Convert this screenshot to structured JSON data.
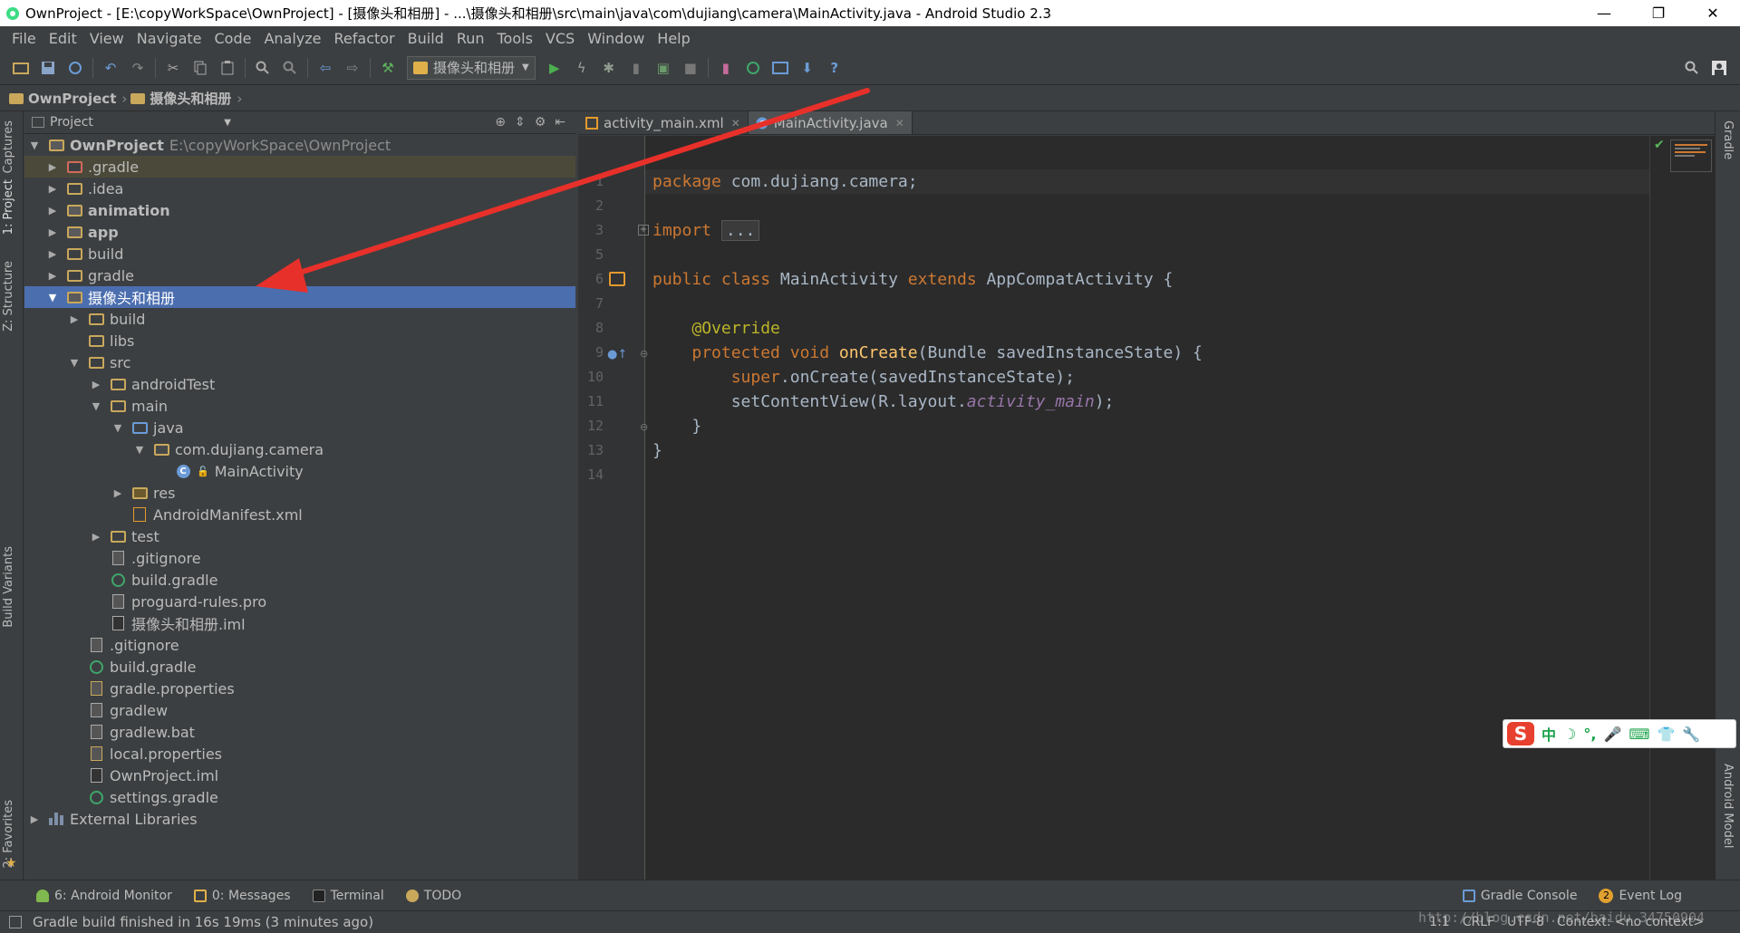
{
  "window": {
    "title": "OwnProject - [E:\\copyWorkSpace\\OwnProject] - [摄像头和相册] - ...\\摄像头和相册\\src\\main\\java\\com\\dujiang\\camera\\MainActivity.java - Android Studio 2.3",
    "minimize": "—",
    "restore": "❐",
    "close": "✕"
  },
  "menu": [
    "File",
    "Edit",
    "View",
    "Navigate",
    "Code",
    "Analyze",
    "Refactor",
    "Build",
    "Run",
    "Tools",
    "VCS",
    "Window",
    "Help"
  ],
  "toolbar": {
    "run_config": "摄像头和相册"
  },
  "navbar": {
    "crumbs": [
      "OwnProject",
      "摄像头和相册"
    ]
  },
  "left_strip": {
    "captures": "Captures",
    "project": "1: Project",
    "structure": "Z: Structure",
    "build_variants": "Build Variants",
    "favorites": "2: Favorites"
  },
  "right_strip": {
    "gradle": "Gradle",
    "android_model": "Android Model"
  },
  "project_panel": {
    "view_selector": "Project",
    "tree": [
      {
        "label": "OwnProject",
        "path": "E:\\copyWorkSpace\\OwnProject"
      },
      {
        "label": ".gradle"
      },
      {
        "label": ".idea"
      },
      {
        "label": "animation"
      },
      {
        "label": "app"
      },
      {
        "label": "build"
      },
      {
        "label": "gradle"
      },
      {
        "label": "摄像头和相册"
      },
      {
        "label": "build"
      },
      {
        "label": "libs"
      },
      {
        "label": "src"
      },
      {
        "label": "androidTest"
      },
      {
        "label": "main"
      },
      {
        "label": "java"
      },
      {
        "label": "com.dujiang.camera"
      },
      {
        "label": "MainActivity"
      },
      {
        "label": "res"
      },
      {
        "label": "AndroidManifest.xml"
      },
      {
        "label": "test"
      },
      {
        "label": ".gitignore"
      },
      {
        "label": "build.gradle"
      },
      {
        "label": "proguard-rules.pro"
      },
      {
        "label": "摄像头和相册.iml"
      },
      {
        "label": ".gitignore"
      },
      {
        "label": "build.gradle"
      },
      {
        "label": "gradle.properties"
      },
      {
        "label": "gradlew"
      },
      {
        "label": "gradlew.bat"
      },
      {
        "label": "local.properties"
      },
      {
        "label": "OwnProject.iml"
      },
      {
        "label": "settings.gradle"
      },
      {
        "label": "External Libraries"
      }
    ]
  },
  "editor": {
    "tabs": [
      "activity_main.xml",
      "MainActivity.java"
    ],
    "line_numbers": [
      "1",
      "2",
      "3",
      "5",
      "6",
      "7",
      "8",
      "9",
      "10",
      "11",
      "12",
      "13",
      "14"
    ],
    "code": {
      "l1_kw": "package",
      "l1_rest": " com.dujiang.camera;",
      "l3_kw": "import",
      "l3_fold": "...",
      "l6_kw": "public class",
      "l6_name": " MainActivity ",
      "l6_kw2": "extends",
      "l6_rest": " AppCompatActivity {",
      "l8_ann": "@Override",
      "l9_kw": "protected void",
      "l9_fn": " onCreate",
      "l9_rest": "(Bundle savedInstanceState) {",
      "l10_kw": "super",
      "l10_rest": ".onCreate(savedInstanceState);",
      "l11_a": "setContentView(R.layout.",
      "l11_it": "activity_main",
      "l11_b": ");",
      "l12": "}",
      "l13": "}"
    }
  },
  "bottom_tabs": {
    "android_monitor": "6: Android Monitor",
    "messages": "0: Messages",
    "terminal": "Terminal",
    "todo": "TODO",
    "gradle_console": "Gradle Console",
    "event_log": "Event Log",
    "event_badge": "2"
  },
  "status": {
    "message": "Gradle build finished in 16s 19ms (3 minutes ago)",
    "position": "1:1",
    "line_sep": "CRLF",
    "encoding": "UTF-8",
    "context": "Context: <no context>",
    "watermark": "http://blog.csdn.net/baidu_34750904"
  },
  "ime": {
    "logo": "S",
    "items": [
      "中",
      "☽",
      "°,",
      "🎤",
      "⌨",
      "👕",
      "🔧"
    ]
  },
  "colors": {
    "selection": "#4b6eaf",
    "keyword": "#cc7832",
    "annotation": "#bbb529",
    "function": "#ffc66d",
    "arrow": "#e8302a"
  }
}
